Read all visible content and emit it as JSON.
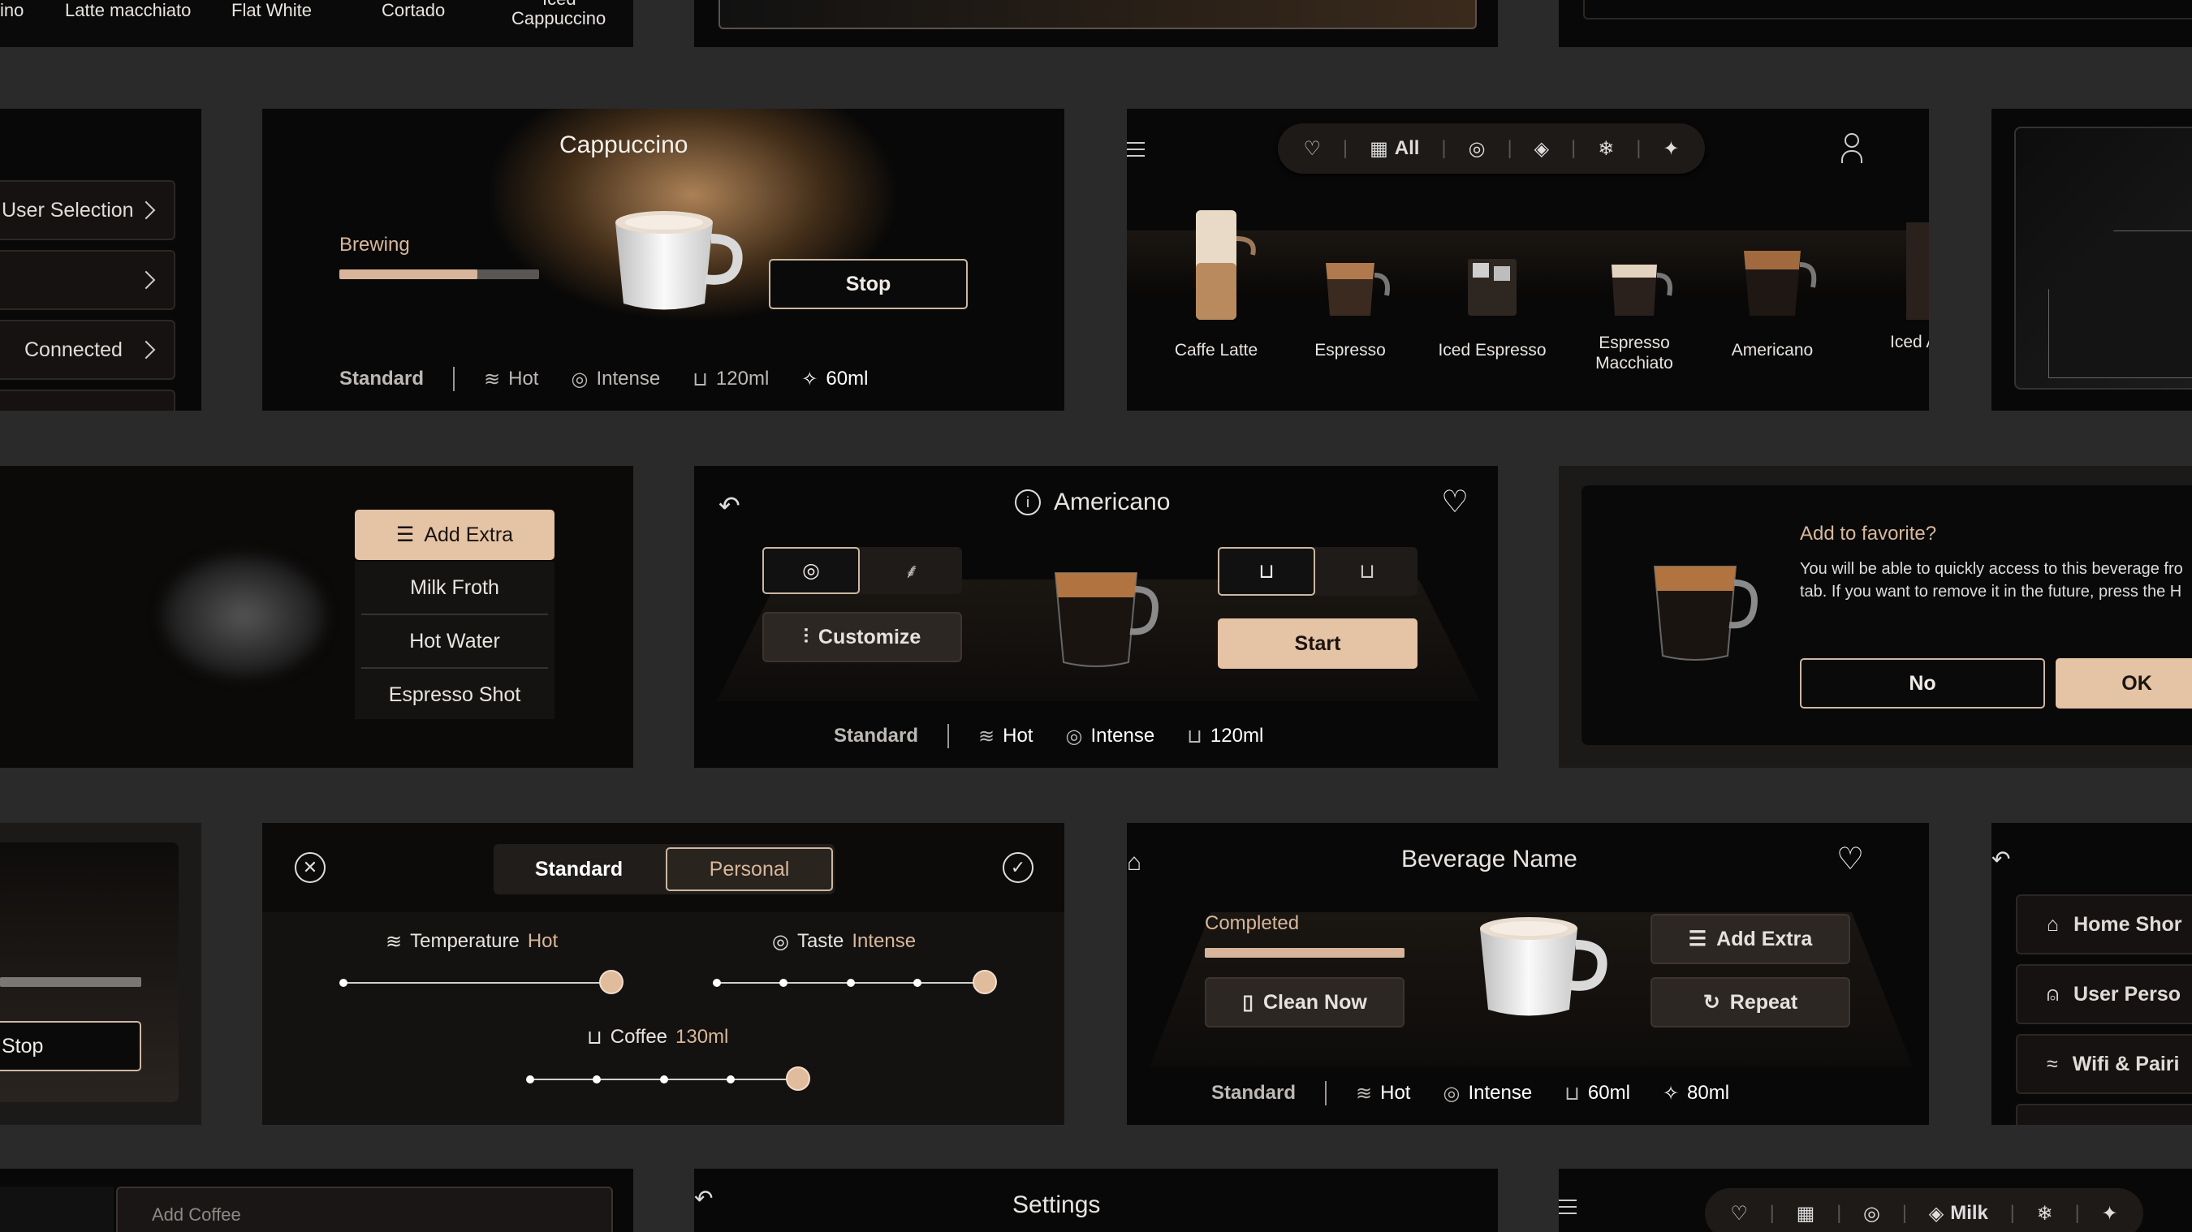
{
  "top_row": {
    "drinks": [
      "ino",
      "Latte macchiato",
      "Flat White",
      "Cortado",
      "Iced",
      "Cappuccino"
    ]
  },
  "settings_list": {
    "items": [
      "User Selection",
      "",
      "Connected"
    ]
  },
  "brewing": {
    "title": "Cappuccino",
    "status": "Brewing",
    "progress": 0.69,
    "stop_label": "Stop",
    "specs": {
      "mode": "Standard",
      "temp": "Hot",
      "taste": "Intense",
      "coffee": "120ml",
      "milk": "60ml"
    }
  },
  "catalog": {
    "filter_all": "All",
    "drinks": [
      "Caffe Latte",
      "Espresso",
      "Iced Espresso",
      "Espresso Macchiato",
      "Americano",
      "Iced Am"
    ]
  },
  "extras": {
    "add_extra": "Add Extra",
    "items": [
      "Milk Froth",
      "Hot Water",
      "Espresso Shot"
    ]
  },
  "americano": {
    "title": "Americano",
    "customize": "Customize",
    "start": "Start",
    "specs": {
      "mode": "Standard",
      "temp": "Hot",
      "taste": "Intense",
      "coffee": "120ml"
    }
  },
  "favorite": {
    "title": "Add to favorite?",
    "body_line1": "You will be able to quickly access to this beverage fro",
    "body_line2": "tab. If you want to remove it in the future, press the H",
    "no": "No",
    "ok": "OK"
  },
  "stop_fragment": {
    "stop": "Stop"
  },
  "customize": {
    "tab_standard": "Standard",
    "tab_personal": "Personal",
    "temperature_label": "Temperature",
    "temperature_value": "Hot",
    "temperature_level": 1.0,
    "taste_label": "Taste",
    "taste_value": "Intense",
    "taste_level": 1.0,
    "coffee_label": "Coffee",
    "coffee_value": "130ml",
    "coffee_level": 1.0
  },
  "completed": {
    "title": "Beverage Name",
    "status": "Completed",
    "progress": 1.0,
    "add_extra": "Add Extra",
    "clean_now": "Clean Now",
    "repeat": "Repeat",
    "specs": {
      "mode": "Standard",
      "temp": "Hot",
      "taste": "Intense",
      "coffee": "60ml",
      "milk": "80ml"
    }
  },
  "settings_menu": {
    "items": [
      "Home Shor",
      "User Perso",
      "Wifi & Pairi"
    ]
  },
  "bottom_row": {
    "add_coffee": "Add Coffee",
    "settings_title": "Settings",
    "filter_milk": "Milk"
  },
  "colors": {
    "accent": "#e5c3a5",
    "panel": "#080808",
    "background": "#2a2a2a"
  }
}
